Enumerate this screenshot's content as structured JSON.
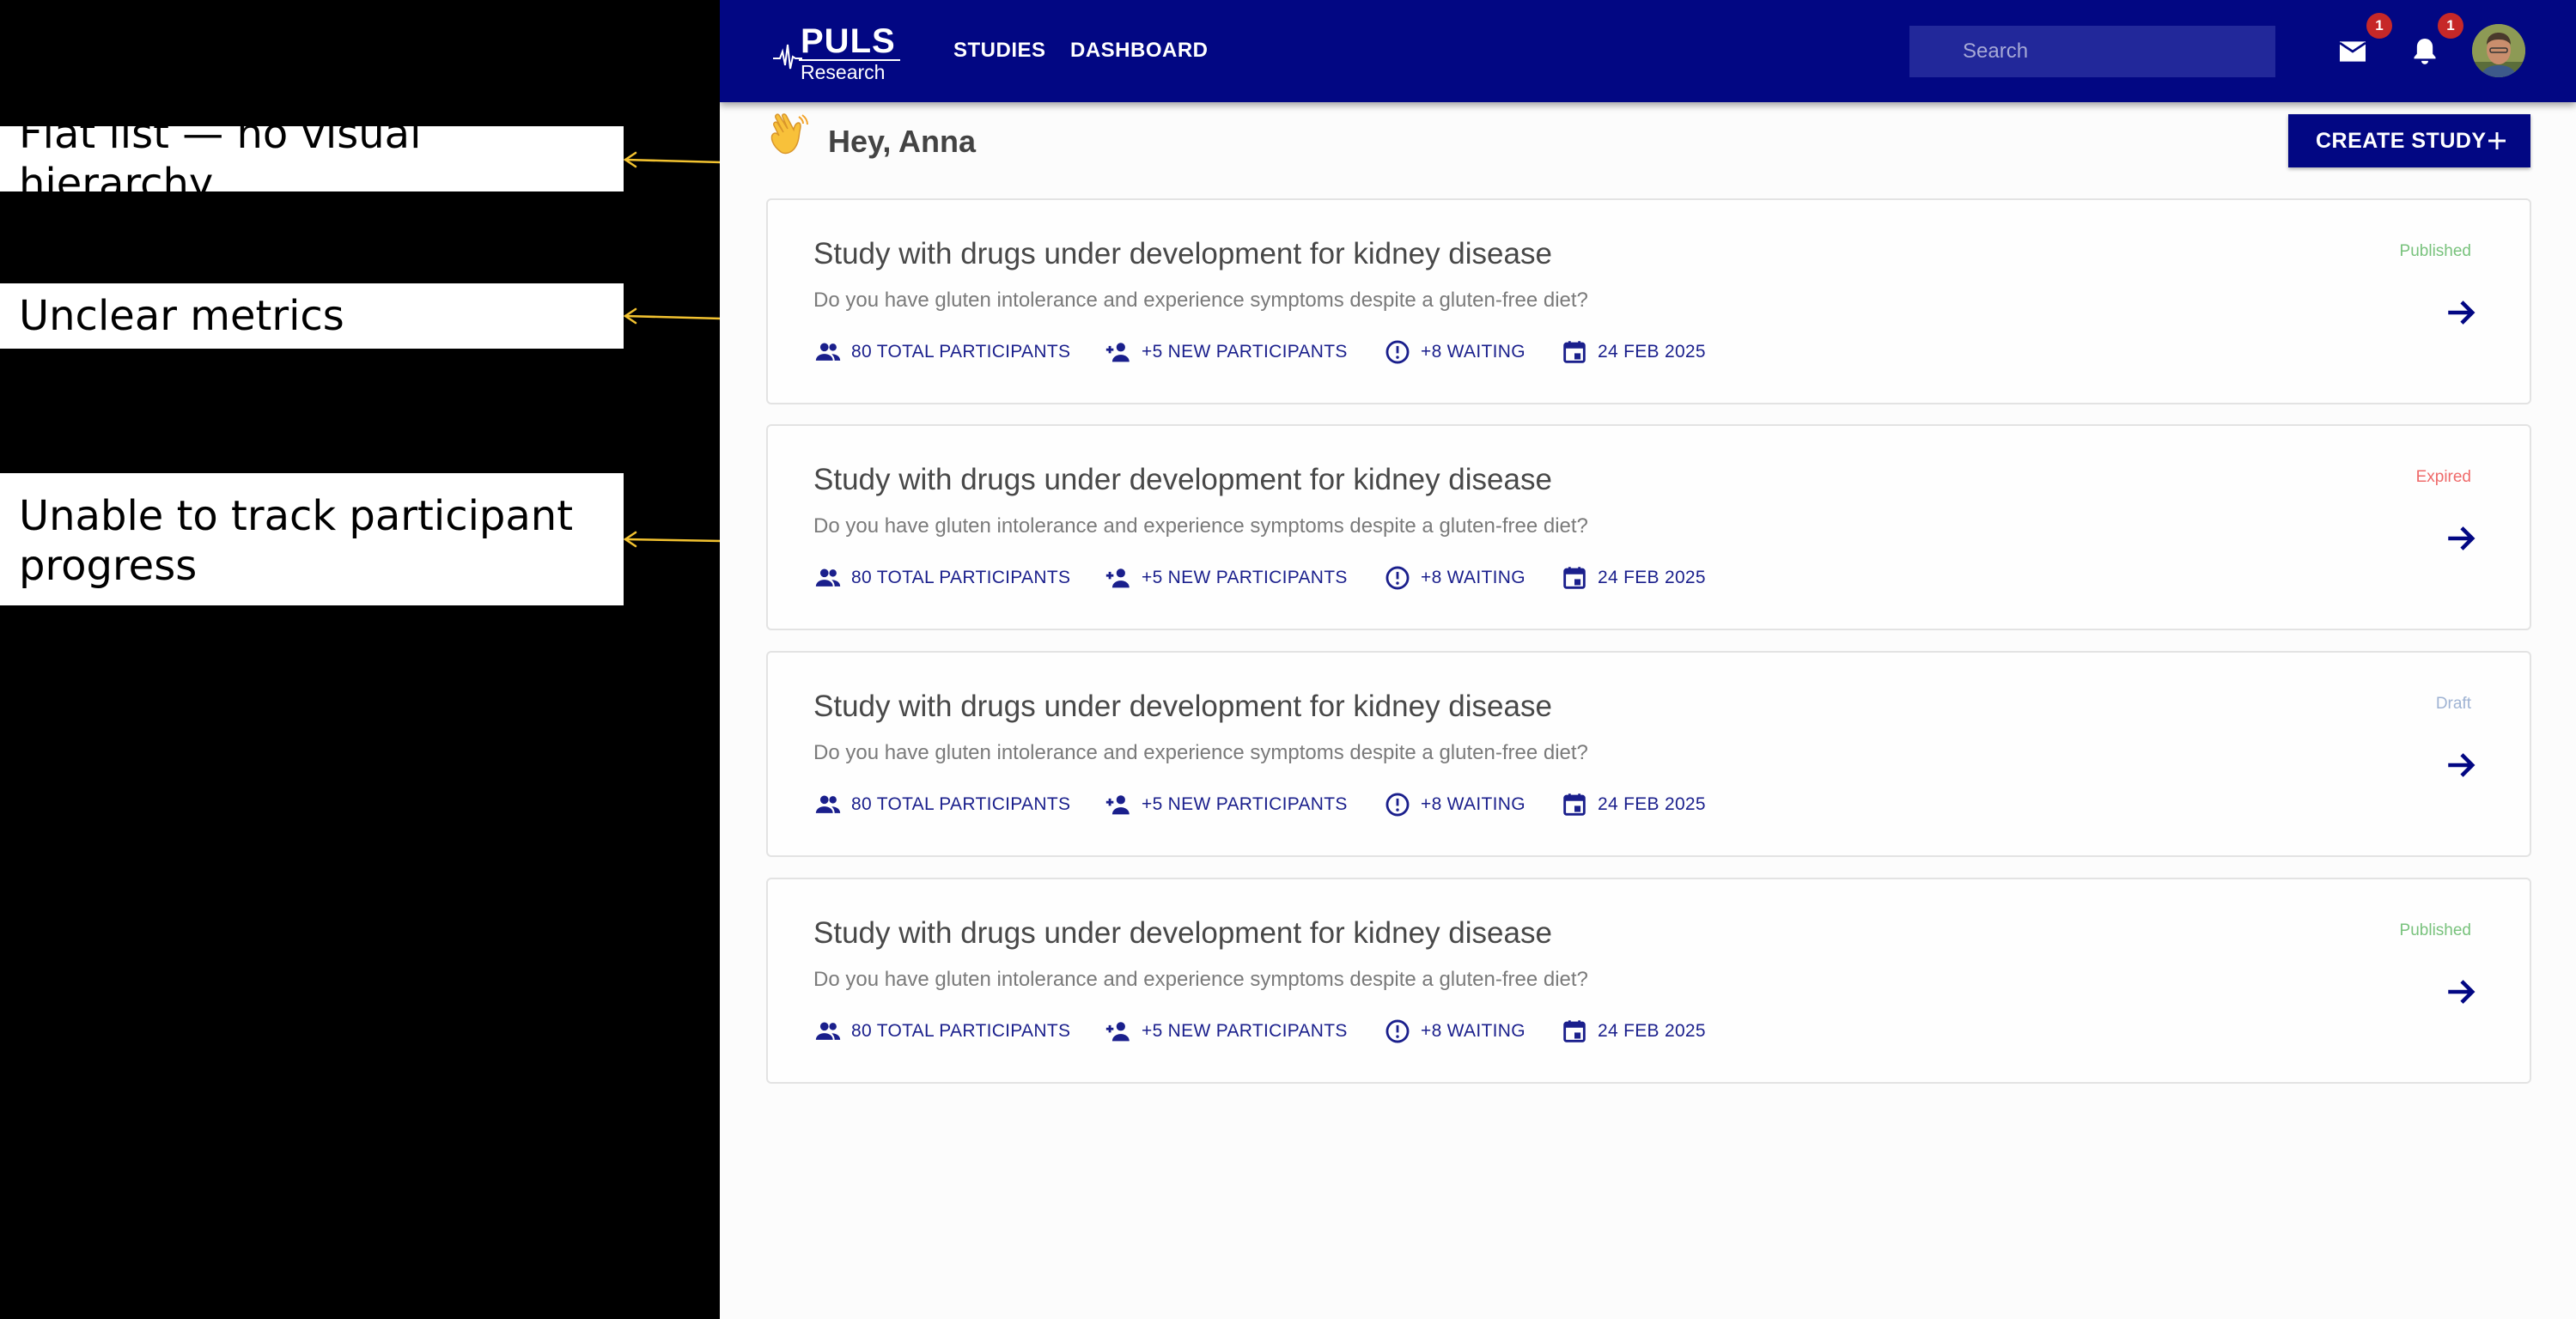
{
  "annotations": [
    {
      "text": "Flat list — no visual hierarchy"
    },
    {
      "text": "Unclear metrics"
    },
    {
      "text": "Unable to track participant progress"
    }
  ],
  "colors": {
    "brand": "#020783",
    "annotation_arrow": "#f2c230",
    "status_published": "#78c27c",
    "status_expired": "#ef6a6a",
    "status_draft": "#9fb3d3"
  },
  "header": {
    "logo_title": "PULS",
    "logo_subtitle": "Research",
    "nav": [
      {
        "label": "STUDIES"
      },
      {
        "label": "DASHBOARD"
      }
    ],
    "search_placeholder": "Search",
    "mail_badge": "1",
    "notifications_badge": "1",
    "icons": [
      "mail-icon",
      "bell-icon",
      "avatar"
    ]
  },
  "main": {
    "greeting_emoji": "waving-hand",
    "greeting": "Hey, Anna",
    "create_button": "CREATE STUDY",
    "studies": [
      {
        "title": "Study with drugs under development for kidney disease",
        "description": "Do you have gluten intolerance and experience symptoms despite a gluten-free diet?",
        "status": "Published",
        "total_participants": "80 TOTAL PARTICIPANTS",
        "new_participants": "+5 NEW PARTICIPANTS",
        "waiting": "+8 WAITING",
        "date": "24 FEB 2025"
      },
      {
        "title": "Study with drugs under development for kidney disease",
        "description": "Do you have gluten intolerance and experience symptoms despite a gluten-free diet?",
        "status": "Expired",
        "total_participants": "80 TOTAL PARTICIPANTS",
        "new_participants": "+5 NEW PARTICIPANTS",
        "waiting": "+8 WAITING",
        "date": "24 FEB 2025"
      },
      {
        "title": "Study with drugs under development for kidney disease",
        "description": "Do you have gluten intolerance and experience symptoms despite a gluten-free diet?",
        "status": "Draft",
        "total_participants": "80 TOTAL PARTICIPANTS",
        "new_participants": "+5 NEW PARTICIPANTS",
        "waiting": "+8 WAITING",
        "date": "24 FEB 2025"
      },
      {
        "title": "Study with drugs under development for kidney disease",
        "description": "Do you have gluten intolerance and experience symptoms despite a gluten-free diet?",
        "status": "Published",
        "total_participants": "80 TOTAL PARTICIPANTS",
        "new_participants": "+5 NEW PARTICIPANTS",
        "waiting": "+8 WAITING",
        "date": "24 FEB 2025"
      }
    ]
  }
}
